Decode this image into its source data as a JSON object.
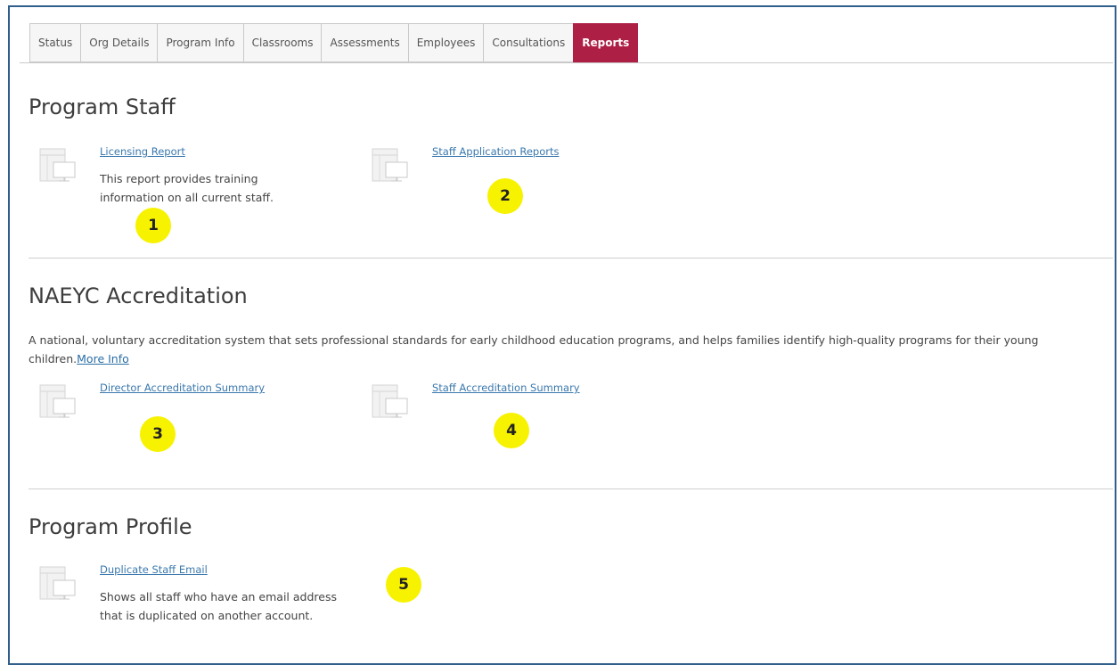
{
  "tabs": [
    {
      "label": "Status",
      "active": false
    },
    {
      "label": "Org Details",
      "active": false
    },
    {
      "label": "Program Info",
      "active": false
    },
    {
      "label": "Classrooms",
      "active": false
    },
    {
      "label": "Assessments",
      "active": false
    },
    {
      "label": "Employees",
      "active": false
    },
    {
      "label": "Consultations",
      "active": false
    },
    {
      "label": "Reports",
      "active": true
    }
  ],
  "colors": {
    "active_tab": "#ad1f45",
    "link": "#3a78ad",
    "badge": "#f7f200",
    "frame_border": "#2f5f8a"
  },
  "sections": {
    "program_staff": {
      "title": "Program Staff",
      "reports": [
        {
          "link": "Licensing Report",
          "description": "This report provides training information on all current staff.",
          "icon": "report-icon",
          "badge": "1"
        },
        {
          "link": "Staff Application Reports",
          "description": "",
          "icon": "report-icon",
          "badge": "2"
        }
      ]
    },
    "naeyc": {
      "title": "NAEYC Accreditation",
      "description": "A national, voluntary accreditation system that sets professional standards for early childhood education programs, and helps families identify high-quality programs for their young children.",
      "more_info": "More Info",
      "reports": [
        {
          "link": "Director Accreditation Summary",
          "description": "",
          "icon": "report-icon",
          "badge": "3"
        },
        {
          "link": "Staff Accreditation Summary",
          "description": "",
          "icon": "report-icon",
          "badge": "4"
        }
      ]
    },
    "program_profile": {
      "title": "Program Profile",
      "reports": [
        {
          "link": "Duplicate Staff Email",
          "description": "Shows all staff who have an email address that is duplicated on another account.",
          "icon": "report-icon",
          "badge": "5"
        }
      ]
    }
  }
}
